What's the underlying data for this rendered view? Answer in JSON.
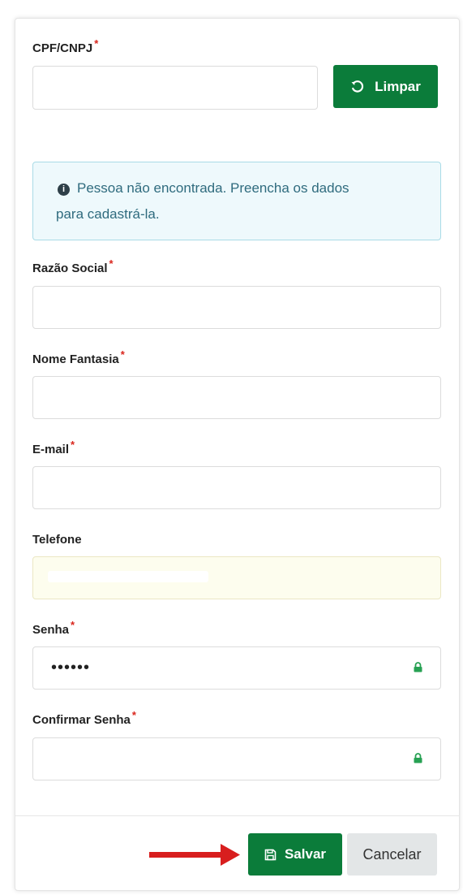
{
  "form": {
    "cpf_label": "CPF/CNPJ",
    "cpf_value": "",
    "required_mark": "*",
    "clear_button": "Limpar",
    "alert_text_line1": "Pessoa não encontrada. Preencha os dados",
    "alert_text_line2": "para cadastrá-la.",
    "razao_label": "Razão Social",
    "fantasia_label": "Nome Fantasia",
    "email_label": "E-mail",
    "telefone_label": "Telefone",
    "senha_label": "Senha",
    "senha_value": "••••••",
    "confirmar_label": "Confirmar Senha"
  },
  "footer": {
    "save_button": "Salvar",
    "cancel_button": "Cancelar"
  },
  "colors": {
    "primary_green": "#0b7c3a",
    "required_red": "#d9251c",
    "alert_bg": "#eef9fc",
    "autofill_bg": "#fdfdee",
    "arrow_red": "#d81e1e"
  },
  "icons": [
    "undo-icon",
    "info-icon",
    "lock-icon",
    "save-icon",
    "arrow-right-icon"
  ]
}
